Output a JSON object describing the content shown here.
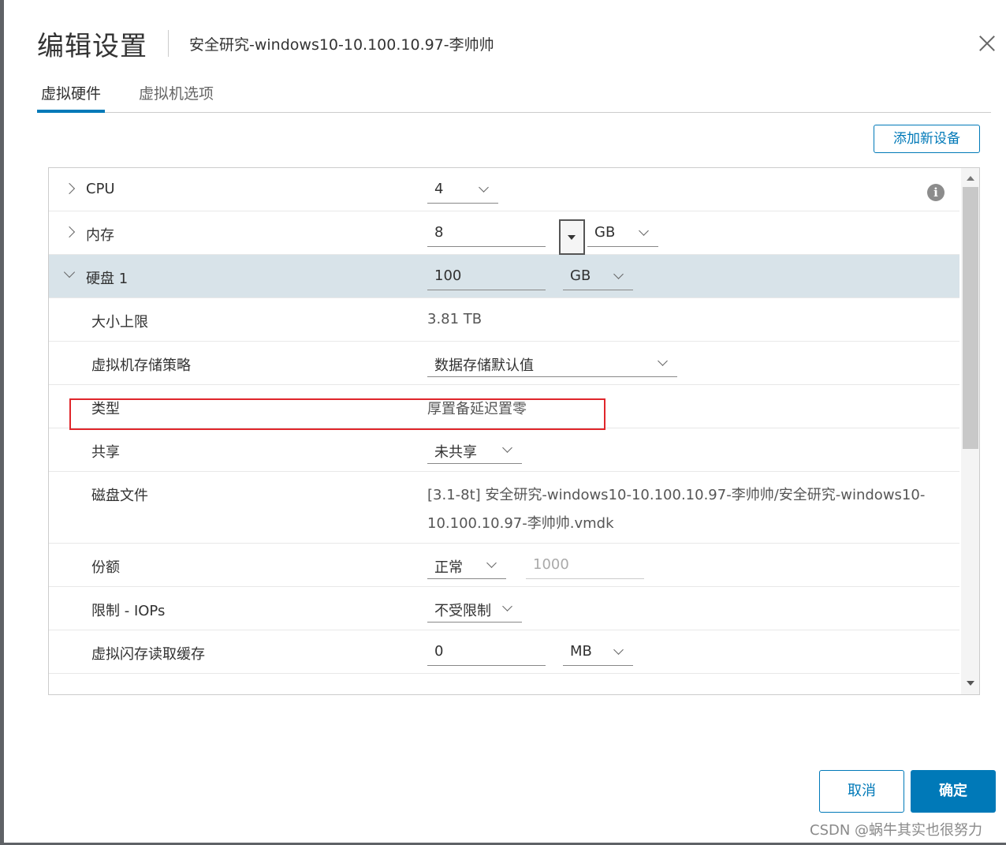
{
  "dialog": {
    "title": "编辑设置",
    "subtitle": "安全研究-windows10-10.100.10.97-李帅帅",
    "close_icon": "close-icon"
  },
  "tabs": [
    {
      "label": "虚拟硬件",
      "active": true
    },
    {
      "label": "虚拟机选项",
      "active": false
    }
  ],
  "add_device_label": "添加新设备",
  "hardware": {
    "cpu": {
      "label": "CPU",
      "value": "4"
    },
    "memory": {
      "label": "内存",
      "value": "8",
      "unit": "GB"
    },
    "disk": {
      "label": "硬盘 1",
      "value": "100",
      "unit": "GB"
    },
    "max_size": {
      "label": "大小上限",
      "value": "3.81 TB"
    },
    "storage_policy": {
      "label": "虚拟机存储策略",
      "value": "数据存储默认值"
    },
    "type": {
      "label": "类型",
      "value": "厚置备延迟置零"
    },
    "sharing": {
      "label": "共享",
      "value": "未共享"
    },
    "disk_file": {
      "label": "磁盘文件",
      "value": "[3.1-8t] 安全研究-windows10-10.100.10.97-李帅帅/安全研究-windows10-10.100.10.97-李帅帅.vmdk"
    },
    "shares": {
      "label": "份额",
      "value": "正常",
      "amount": "1000"
    },
    "limit_iops": {
      "label": "限制 - IOPs",
      "value": "不受限制"
    },
    "flash_cache": {
      "label": "虚拟闪存读取缓存",
      "value": "0",
      "unit": "MB"
    }
  },
  "info_icon_glyph": "i",
  "highlight_color": "#e0262b",
  "accent_color": "#0079b8",
  "footer": {
    "cancel_label": "取消",
    "ok_label": "确定"
  },
  "watermark": "CSDN @蜗牛其实也很努力"
}
